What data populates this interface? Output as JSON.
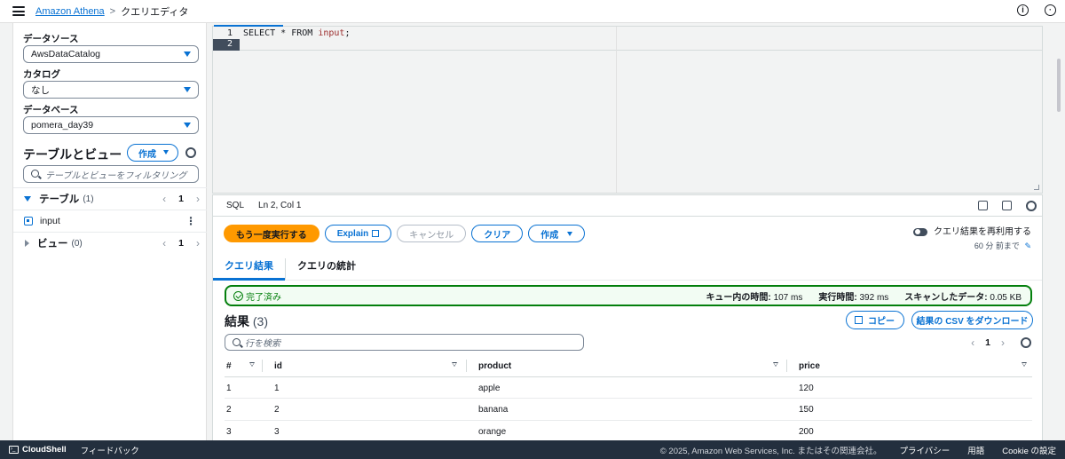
{
  "topbar": {
    "service": "Amazon Athena",
    "separator": ">",
    "current": "クエリエディタ"
  },
  "sidebar": {
    "datasource_label": "データソース",
    "datasource_value": "AwsDataCatalog",
    "catalog_label": "カタログ",
    "catalog_value": "なし",
    "database_label": "データベース",
    "database_value": "pomera_day39",
    "tables_views_title": "テーブルとビュー",
    "create_button": "作成",
    "filter_placeholder": "テーブルとビューをフィルタリング",
    "tables_title": "テーブル",
    "tables_count": "(1)",
    "tables_page": "1",
    "table_items": [
      "input"
    ],
    "views_title": "ビュー",
    "views_count": "(0)",
    "views_page": "1"
  },
  "editor": {
    "line_numbers": [
      "1",
      "2"
    ],
    "code_tokens": {
      "select": "SELECT",
      "star": "*",
      "from": "FROM",
      "table": "input",
      "semi": ";"
    }
  },
  "statusbar": {
    "language": "SQL",
    "position": "Ln 2, Col 1"
  },
  "actions": {
    "rerun": "もう一度実行する",
    "explain": "Explain",
    "cancel": "キャンセル",
    "clear": "クリア",
    "create": "作成",
    "reuse_label": "クエリ結果を再利用する",
    "reuse_sub": "60 分 前まで"
  },
  "tabs": {
    "results": "クエリ結果",
    "stats": "クエリの統計"
  },
  "status": {
    "state": "完了済み",
    "queue_label": "キュー内の時間:",
    "queue_value": "107 ms",
    "exec_label": "実行時間:",
    "exec_value": "392 ms",
    "scan_label": "スキャンしたデータ:",
    "scan_value": "0.05 KB"
  },
  "results": {
    "title": "結果",
    "count": "(3)",
    "copy": "コピー",
    "download": "結果の CSV をダウンロード",
    "filter_placeholder": "行を検索",
    "page": "1",
    "columns": [
      "#",
      "id",
      "product",
      "price"
    ],
    "rows": [
      [
        "1",
        "1",
        "apple",
        "120"
      ],
      [
        "2",
        "2",
        "banana",
        "150"
      ],
      [
        "3",
        "3",
        "orange",
        "200"
      ]
    ]
  },
  "footer": {
    "cloudshell": "CloudShell",
    "feedback": "フィードバック",
    "copyright": "© 2025, Amazon Web Services, Inc. またはその関連会社。",
    "privacy": "プライバシー",
    "terms": "用語",
    "cookie": "Cookie の設定"
  },
  "colors": {
    "accent": "#0972d3",
    "primary_button": "#ff9900",
    "success": "#037f0c",
    "footer_bg": "#232f3e"
  }
}
